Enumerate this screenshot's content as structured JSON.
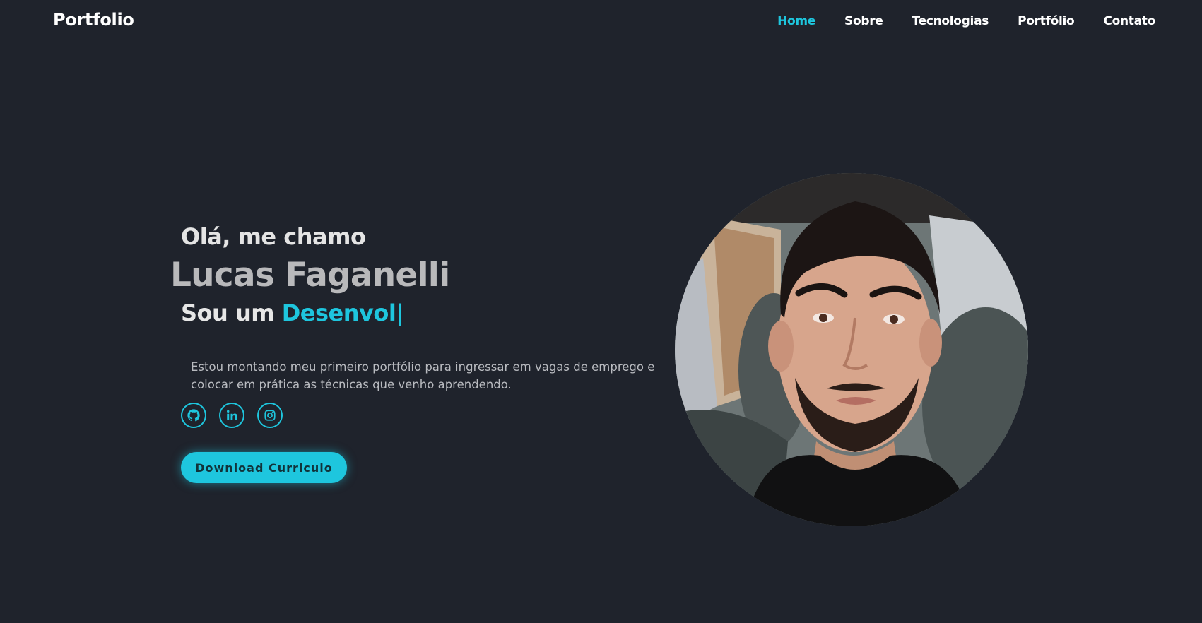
{
  "header": {
    "brand": "Portfolio",
    "nav": [
      {
        "label": "Home",
        "active": true
      },
      {
        "label": "Sobre",
        "active": false
      },
      {
        "label": "Tecnologias",
        "active": false
      },
      {
        "label": "Portfólio",
        "active": false
      },
      {
        "label": "Contato",
        "active": false
      }
    ]
  },
  "hero": {
    "greeting": "Olá, me chamo",
    "name": "Lucas Faganelli",
    "role_prefix": "Sou um",
    "role_typed": "Desenvol",
    "cursor": "|",
    "intro": "Estou montando meu primeiro portfólio para ingressar em vagas de emprego e colocar em prática as técnicas que venho aprendendo.",
    "socials": [
      {
        "icon": "github-icon"
      },
      {
        "icon": "linkedin-icon"
      },
      {
        "icon": "instagram-icon"
      }
    ],
    "download_label": "Download Curriculo",
    "avatar": "profile-photo"
  },
  "colors": {
    "background": "#1f232c",
    "accent": "#1ec6de",
    "text": "#ffffff"
  }
}
